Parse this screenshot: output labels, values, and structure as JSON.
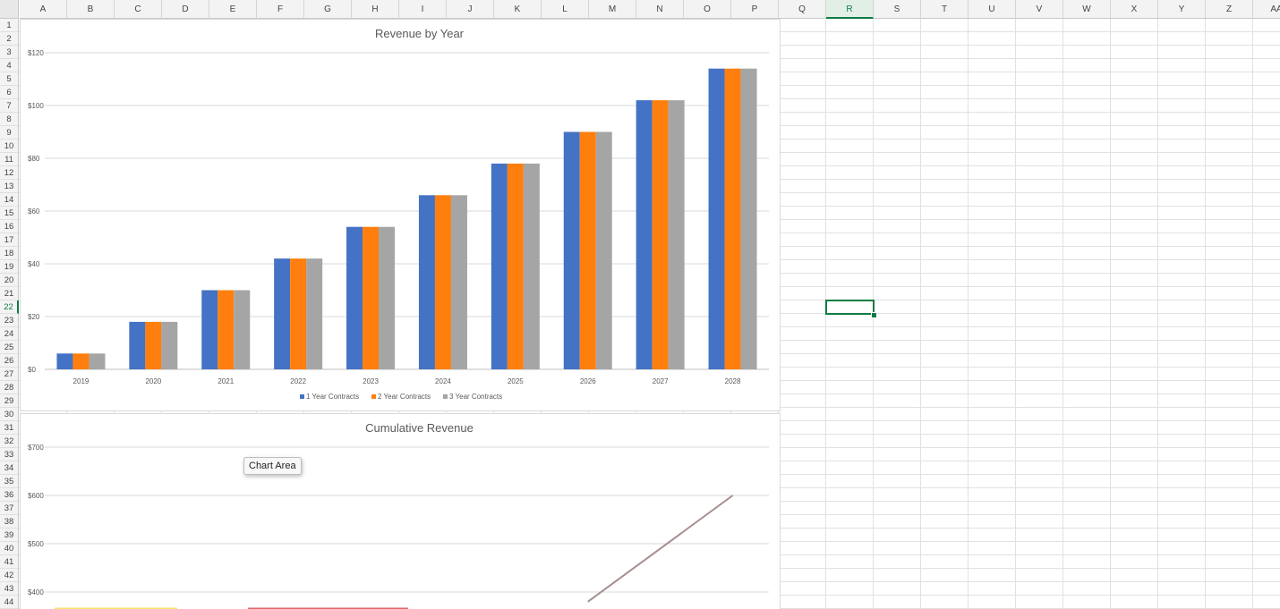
{
  "spreadsheet": {
    "columns": [
      "A",
      "B",
      "C",
      "D",
      "E",
      "F",
      "G",
      "H",
      "I",
      "J",
      "K",
      "L",
      "M",
      "N",
      "O",
      "P",
      "Q",
      "R",
      "S",
      "T",
      "U",
      "V",
      "W",
      "X",
      "Y",
      "Z",
      "AA"
    ],
    "active_column": "R",
    "rows": [
      "1",
      "2",
      "3",
      "4",
      "5",
      "6",
      "7",
      "8",
      "9",
      "10",
      "11",
      "12",
      "13",
      "14",
      "15",
      "16",
      "17",
      "18",
      "19",
      "20",
      "21",
      "22",
      "23",
      "24",
      "25",
      "26",
      "27",
      "28",
      "29",
      "30",
      "31",
      "32",
      "33",
      "34",
      "35",
      "36",
      "37",
      "38",
      "39",
      "40",
      "41",
      "42",
      "43",
      "44"
    ],
    "active_row": "22",
    "selected_cell": "R22"
  },
  "tooltip": {
    "text": "Chart Area"
  },
  "colors": {
    "series1": "#4472c4",
    "series2": "#ff7f0e",
    "series3": "#a5a5a5",
    "selection": "#107c41"
  },
  "chart_data": [
    {
      "type": "bar",
      "title": "Revenue by Year",
      "categories": [
        "2019",
        "2020",
        "2021",
        "2022",
        "2023",
        "2024",
        "2025",
        "2026",
        "2027",
        "2028"
      ],
      "series": [
        {
          "name": "1 Year Contracts",
          "values": [
            6,
            18,
            30,
            42,
            54,
            66,
            78,
            90,
            102,
            114
          ]
        },
        {
          "name": "2 Year Contracts",
          "values": [
            6,
            18,
            30,
            42,
            54,
            66,
            78,
            90,
            102,
            114
          ]
        },
        {
          "name": "3 Year Contracts",
          "values": [
            6,
            18,
            30,
            42,
            54,
            66,
            78,
            90,
            102,
            114
          ]
        }
      ],
      "y_ticks": [
        "$0",
        "$20",
        "$40",
        "$60",
        "$80",
        "$100",
        "$120"
      ],
      "ylim": [
        0,
        120
      ],
      "grid": true,
      "legend_position": "bottom"
    },
    {
      "type": "line",
      "title": "Cumulative Revenue",
      "y_ticks": [
        "$400",
        "$500",
        "$600",
        "$700"
      ],
      "ylim": [
        400,
        700
      ],
      "visible_points": [
        {
          "x": "2026",
          "y": 380
        },
        {
          "x": "2027",
          "y": 490
        },
        {
          "x": "2028",
          "y": 600
        }
      ],
      "grid": true
    }
  ]
}
